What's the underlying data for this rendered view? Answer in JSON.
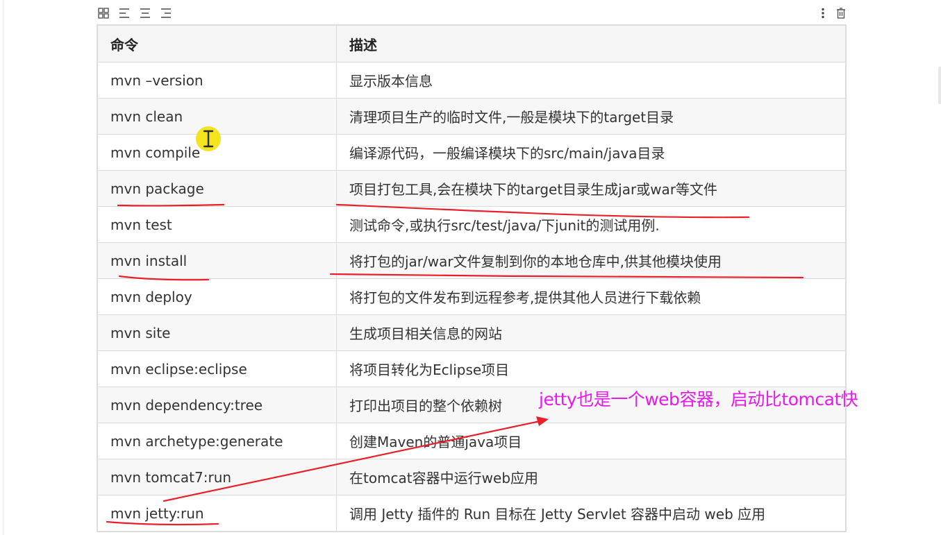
{
  "toolbar": {
    "icons": [
      "table-grid-icon",
      "align-left-icon",
      "align-center-icon",
      "align-right-icon",
      "more-vertical-icon",
      "trash-icon"
    ]
  },
  "table": {
    "headers": [
      "命令",
      "描述"
    ],
    "rows": [
      {
        "command": "mvn –version",
        "description": "显示版本信息"
      },
      {
        "command": "mvn clean",
        "description": "清理项目生产的临时文件,一般是模块下的target目录"
      },
      {
        "command": "mvn compile",
        "description": "编译源代码，一般编译模块下的src/main/java目录"
      },
      {
        "command": "mvn package",
        "description": "项目打包工具,会在模块下的target目录生成jar或war等文件"
      },
      {
        "command": "mvn test",
        "description": "测试命令,或执行src/test/java/下junit的测试用例."
      },
      {
        "command": "mvn install",
        "description": "将打包的jar/war文件复制到你的本地仓库中,供其他模块使用"
      },
      {
        "command": "mvn deploy",
        "description": "将打包的文件发布到远程参考,提供其他人员进行下载依赖"
      },
      {
        "command": "mvn site",
        "description": "生成项目相关信息的网站"
      },
      {
        "command": "mvn eclipse:eclipse",
        "description": "将项目转化为Eclipse项目"
      },
      {
        "command": "mvn dependency:tree",
        "description": "打印出项目的整个依赖树"
      },
      {
        "command": "mvn archetype:generate",
        "description": "创建Maven的普通java项目"
      },
      {
        "command": "mvn tomcat7:run",
        "description": "在tomcat容器中运行web应用"
      },
      {
        "command": "mvn jetty:run",
        "description": "调用 Jetty 插件的 Run 目标在 Jetty Servlet 容器中启动 web 应用"
      }
    ]
  },
  "annotation": {
    "text": "jetty也是一个web容器，启动比tomcat快",
    "color": "#e61aea"
  },
  "colors": {
    "underline_red": "#e8202a",
    "cursor_highlight": "#f2e313"
  }
}
